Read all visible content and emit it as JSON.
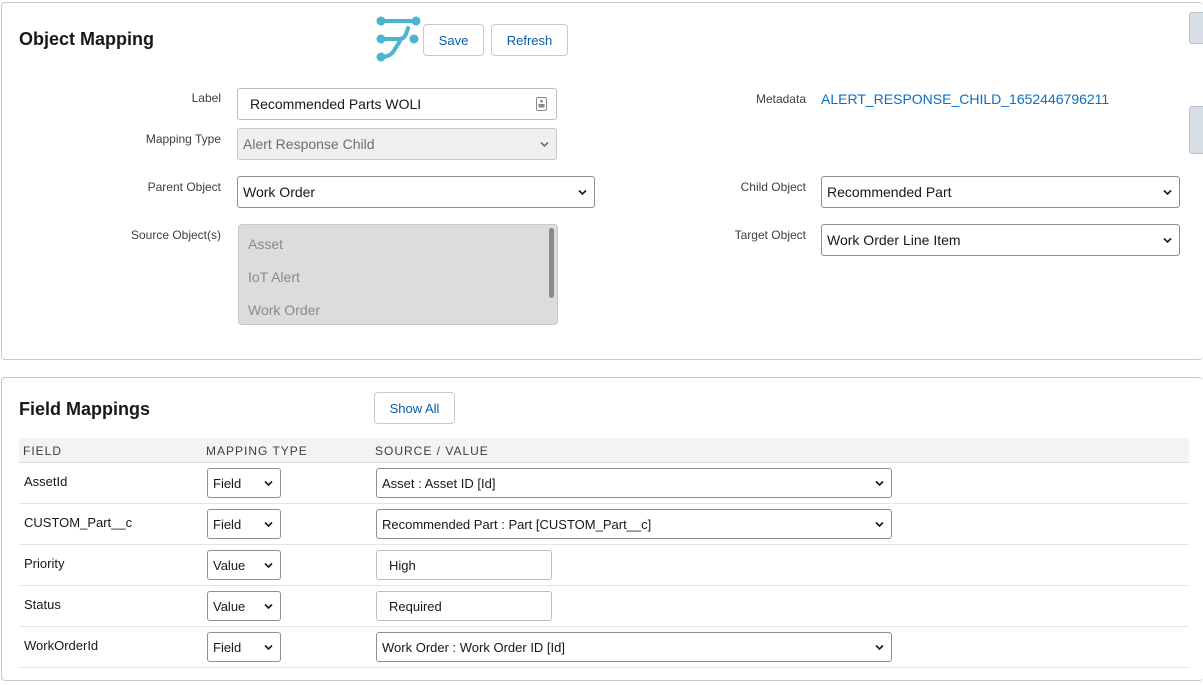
{
  "object_mapping": {
    "title": "Object Mapping",
    "save_label": "Save",
    "refresh_label": "Refresh",
    "label_label": "Label",
    "label_value": "Recommended Parts WOLI",
    "mapping_type_label": "Mapping Type",
    "mapping_type_value": "Alert Response Child",
    "parent_object_label": "Parent Object",
    "parent_object_value": "Work Order",
    "source_objects_label": "Source Object(s)",
    "source_objects": [
      "Asset",
      "IoT Alert",
      "Work Order"
    ],
    "metadata_label": "Metadata",
    "metadata_value": "ALERT_RESPONSE_CHILD_1652446796211",
    "child_object_label": "Child Object",
    "child_object_value": "Recommended Part",
    "target_object_label": "Target Object",
    "target_object_value": "Work Order Line Item"
  },
  "field_mappings": {
    "title": "Field Mappings",
    "show_all_label": "Show All",
    "columns": [
      "FIELD",
      "MAPPING TYPE",
      "SOURCE / VALUE"
    ],
    "rows": [
      {
        "field": "AssetId",
        "mapping_type": "Field",
        "source": "Asset : Asset ID [Id]"
      },
      {
        "field": "CUSTOM_Part__c",
        "mapping_type": "Field",
        "source": "Recommended Part : Part [CUSTOM_Part__c]"
      },
      {
        "field": "Priority",
        "mapping_type": "Value",
        "source": "High"
      },
      {
        "field": "Status",
        "mapping_type": "Value",
        "source": "Required"
      },
      {
        "field": "WorkOrderId",
        "mapping_type": "Field",
        "source": "Work Order : Work Order ID [Id]"
      }
    ]
  },
  "icons": {
    "logo": "flow-mapping-icon",
    "select_arrow": "chevron-down-icon"
  },
  "colors": {
    "accent": "#0b5cab",
    "logo": "#4bb4cf",
    "link": "#0b6fc4"
  }
}
